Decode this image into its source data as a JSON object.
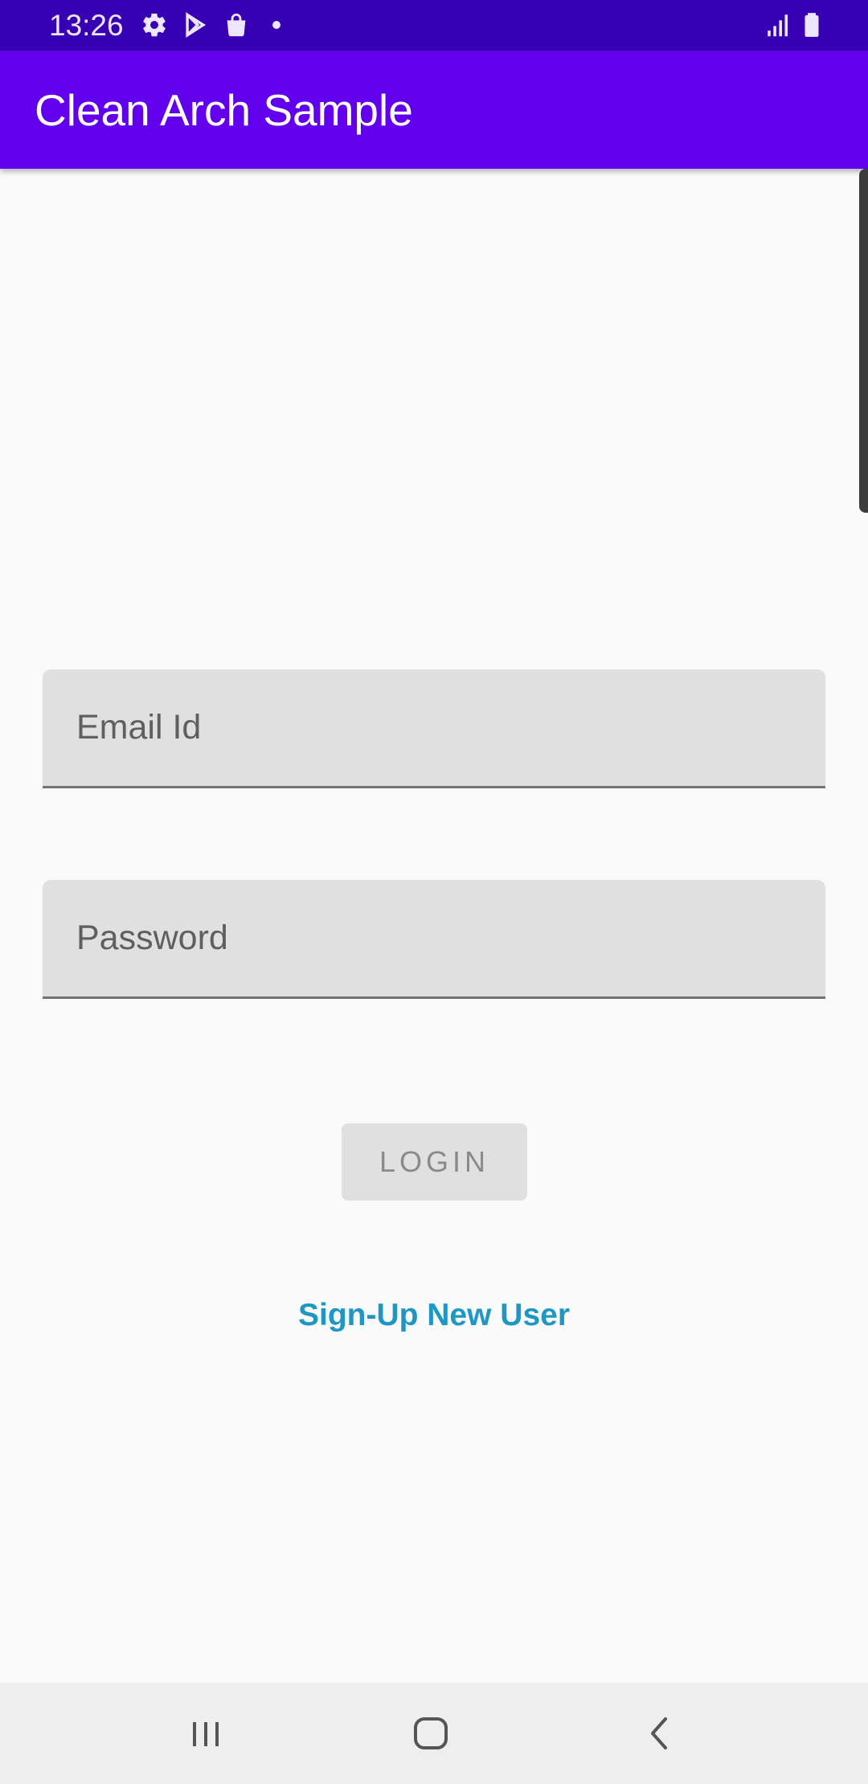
{
  "status_bar": {
    "time": "13:26",
    "icons": [
      "gear-icon",
      "play-store-icon",
      "shopping-bag-icon",
      "notification-dot-icon",
      "signal-icon",
      "battery-icon"
    ]
  },
  "app_bar": {
    "title": "Clean Arch Sample"
  },
  "form": {
    "email_placeholder": "Email Id",
    "password_placeholder": "Password",
    "login_label": "LOGIN",
    "signup_label": "Sign-Up New User"
  },
  "navigation": {
    "items": [
      "recents-icon",
      "home-icon",
      "back-icon"
    ]
  },
  "colors": {
    "status_bar": "#3700B3",
    "app_bar": "#6200EE",
    "link": "#1E97C2",
    "field_background": "#E0E0E0"
  }
}
